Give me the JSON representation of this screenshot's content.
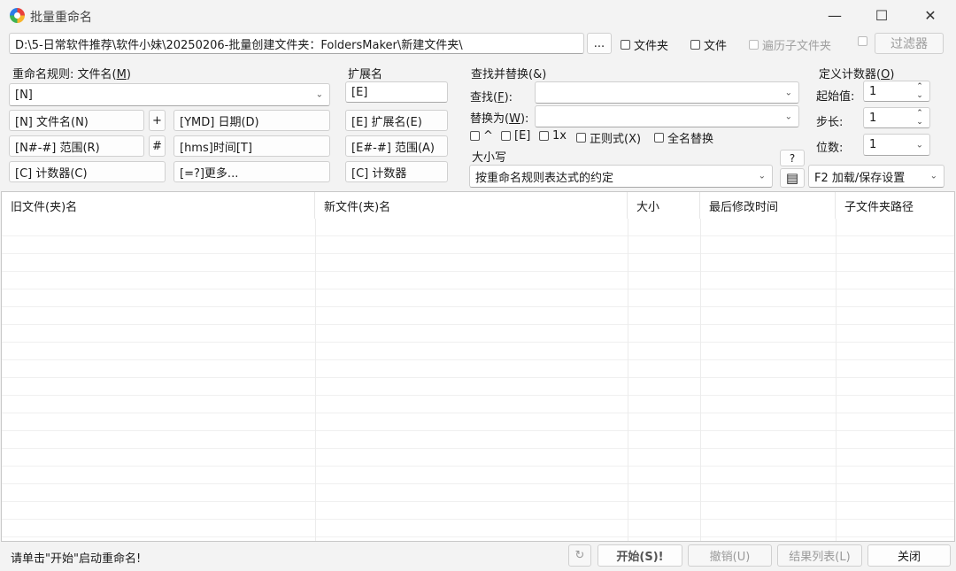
{
  "window": {
    "title": "批量重命名",
    "minimize": "—",
    "maximize": "☐",
    "close": "✕"
  },
  "path": {
    "value": "D:\\5-日常软件推荐\\软件小妹\\20250206-批量创建文件夹：FoldersMaker\\新建文件夹\\",
    "browse_label": "...",
    "folder_label": "文件夹",
    "file_label": "文件",
    "subfolder_label": "遍历子文件夹",
    "filter_label": "过滤器"
  },
  "rename": {
    "header_prefix": "重命名规则: 文件名(",
    "header_key": "M",
    "header_suffix": ")",
    "value": "[N]",
    "buttons": {
      "filename": "[N] 文件名(N)",
      "plus": "+",
      "date": "[YMD] 日期(D)",
      "range": "[N#-#] 范围(R)",
      "hash": "#",
      "time": "[hms]时间[T]",
      "counter": "[C] 计数器(C)",
      "more": "[=?]更多..."
    }
  },
  "extension": {
    "header": "扩展名",
    "value": "[E]",
    "ext_button": "[E] 扩展名(E)",
    "range_button": "[E#-#] 范围(A)",
    "counter_button": "[C] 计数器"
  },
  "find_replace": {
    "header": "查找并替换(&)",
    "find_label_prefix": "查找(",
    "find_key": "F",
    "find_label_suffix": "):",
    "replace_label_prefix": "替换为(",
    "replace_key": "W",
    "replace_label_suffix": "):",
    "find_value": "",
    "replace_value": "",
    "options": {
      "caret": "^",
      "ext": "[E]",
      "once": "1x",
      "regex": "正则式(X)",
      "fullname": "全名替换"
    }
  },
  "case": {
    "header": "大小写",
    "value": "按重命名规则表达式的约定",
    "help_label": "?"
  },
  "counter": {
    "header_prefix": "定义计数器(",
    "header_key": "O",
    "header_suffix": ")",
    "start_label": "起始值:",
    "start_value": "1",
    "step_label": "步长:",
    "step_value": "1",
    "digits_label": "位数:",
    "digits_value": "1"
  },
  "settings": {
    "label": "F2 加载/保存设置"
  },
  "list": {
    "columns": [
      "旧文件(夹)名",
      "新文件(夹)名",
      "大小",
      "最后修改时间",
      "子文件夹路径"
    ]
  },
  "status": {
    "message": "请单击\"开始\"启动重命名!",
    "start_label": "开始(S)!",
    "undo_label": "撤销(U)",
    "results_label": "结果列表(L)",
    "close_label": "关闭"
  }
}
